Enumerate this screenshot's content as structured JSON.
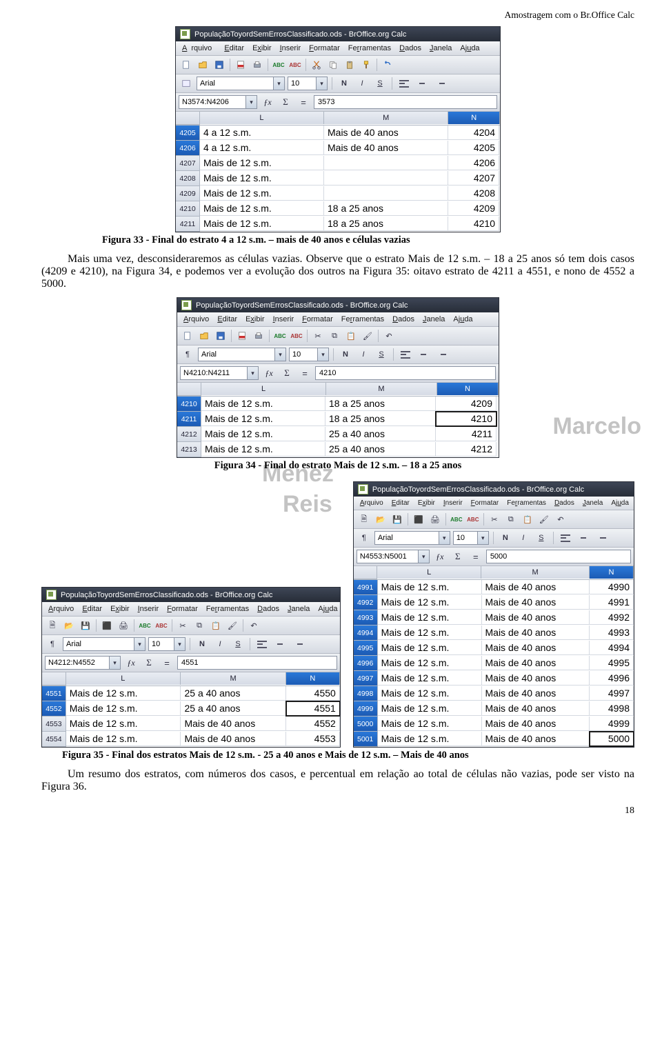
{
  "header_right": "Amostragem com o Br.Office Calc",
  "page_number": "18",
  "calc_common": {
    "title_suffix": " - BrOffice.org Calc",
    "doc_name": "PopulaçãoToyordSemErrosClassificado.ods",
    "menu": [
      "Arquivo",
      "Editar",
      "Exibir",
      "Inserir",
      "Formatar",
      "Ferramentas",
      "Dados",
      "Janela",
      "Ajuda"
    ],
    "font_name": "Arial",
    "font_size": "10",
    "style_btns": {
      "bold": "N",
      "italic": "I",
      "under": "S"
    }
  },
  "fig33": {
    "caption": "Figura 33 - Final do estrato 4 a 12 s.m. – mais de 40 anos  e células vazias",
    "namebox": "N3574:N4206",
    "formula": "3573",
    "col_widths": {
      "rowhead": 34,
      "L": 180,
      "M": 180,
      "N": 74
    },
    "cols": [
      "L",
      "M",
      "N"
    ],
    "sel_col": "N",
    "sel_rows": [
      "4205",
      "4206"
    ],
    "rows": [
      {
        "r": "4205",
        "L": "4 a 12 s.m.",
        "M": "Mais de 40 anos",
        "N": "4204"
      },
      {
        "r": "4206",
        "L": "4 a 12 s.m.",
        "M": "Mais de 40 anos",
        "N": "4205"
      },
      {
        "r": "4207",
        "L": "Mais de 12 s.m.",
        "M": "",
        "N": "4206"
      },
      {
        "r": "4208",
        "L": "Mais de 12 s.m.",
        "M": "",
        "N": "4207"
      },
      {
        "r": "4209",
        "L": "Mais de 12 s.m.",
        "M": "",
        "N": "4208"
      },
      {
        "r": "4210",
        "L": "Mais de 12 s.m.",
        "M": "18 a 25 anos",
        "N": "4209"
      },
      {
        "r": "4211",
        "L": "Mais de 12 s.m.",
        "M": "18 a 25 anos",
        "N": "4210"
      }
    ]
  },
  "para1": "Mais uma vez, desconsideraremos as células vazias. Observe que o estrato Mais de 12 s.m. – 18 a 25 anos só tem dois casos (4209 e 4210), na Figura 34, e podemos ver a evolução dos outros na Figura 35: oitavo estrato de 4211 a 4551, e nono de 4552 a 5000.",
  "fig34": {
    "caption": "Figura 34 - Final do estrato Mais de 12 s.m. – 18 a 25 anos",
    "namebox": "N4210:N4211",
    "formula": "4210",
    "col_widths": {
      "rowhead": 34,
      "L": 180,
      "M": 160,
      "N": 88
    },
    "cols": [
      "L",
      "M",
      "N"
    ],
    "sel_col": "N",
    "sel_rows": [
      "4210",
      "4211"
    ],
    "selcell_row": "4211",
    "rows": [
      {
        "r": "4210",
        "L": "Mais de 12 s.m.",
        "M": "18 a 25 anos",
        "N": "4209"
      },
      {
        "r": "4211",
        "L": "Mais de 12 s.m.",
        "M": "18 a 25 anos",
        "N": "4210"
      },
      {
        "r": "4212",
        "L": "Mais de 12 s.m.",
        "M": "25 a 40 anos",
        "N": "4211"
      },
      {
        "r": "4213",
        "L": "Mais de 12 s.m.",
        "M": "25 a 40 anos",
        "N": "4212"
      }
    ]
  },
  "fig35a": {
    "namebox": "N4212:N4552",
    "formula": "4551",
    "col_widths": {
      "rowhead": 34,
      "L": 168,
      "M": 154,
      "N": 78
    },
    "cols": [
      "L",
      "M",
      "N"
    ],
    "sel_col": "N",
    "sel_rows": [
      "4551",
      "4552"
    ],
    "selcell_row": "4552",
    "rows": [
      {
        "r": "4551",
        "L": "Mais de 12 s.m.",
        "M": "25 a 40 anos",
        "N": "4550"
      },
      {
        "r": "4552",
        "L": "Mais de 12 s.m.",
        "M": "25 a 40 anos",
        "N": "4551"
      },
      {
        "r": "4553",
        "L": "Mais de 12 s.m.",
        "M": "Mais de 40 anos",
        "N": "4552"
      },
      {
        "r": "4554",
        "L": "Mais de 12 s.m.",
        "M": "Mais de 40 anos",
        "N": "4553"
      }
    ]
  },
  "fig35b": {
    "namebox": "N4553:N5001",
    "formula": "5000",
    "col_widths": {
      "rowhead": 34,
      "L": 152,
      "M": 158,
      "N": 64
    },
    "cols": [
      "L",
      "M",
      "N"
    ],
    "sel_col": "N",
    "sel_rows": [
      "4991",
      "4992",
      "4993",
      "4994",
      "4995",
      "4996",
      "4997",
      "4998",
      "4999",
      "5000",
      "5001"
    ],
    "selcell_row": "5001",
    "rows": [
      {
        "r": "4991",
        "L": "Mais de 12 s.m.",
        "M": "Mais de 40 anos",
        "N": "4990"
      },
      {
        "r": "4992",
        "L": "Mais de 12 s.m.",
        "M": "Mais de 40 anos",
        "N": "4991"
      },
      {
        "r": "4993",
        "L": "Mais de 12 s.m.",
        "M": "Mais de 40 anos",
        "N": "4992"
      },
      {
        "r": "4994",
        "L": "Mais de 12 s.m.",
        "M": "Mais de 40 anos",
        "N": "4993"
      },
      {
        "r": "4995",
        "L": "Mais de 12 s.m.",
        "M": "Mais de 40 anos",
        "N": "4994"
      },
      {
        "r": "4996",
        "L": "Mais de 12 s.m.",
        "M": "Mais de 40 anos",
        "N": "4995"
      },
      {
        "r": "4997",
        "L": "Mais de 12 s.m.",
        "M": "Mais de 40 anos",
        "N": "4996"
      },
      {
        "r": "4998",
        "L": "Mais de 12 s.m.",
        "M": "Mais de 40 anos",
        "N": "4997"
      },
      {
        "r": "4999",
        "L": "Mais de 12 s.m.",
        "M": "Mais de 40 anos",
        "N": "4998"
      },
      {
        "r": "5000",
        "L": "Mais de 12 s.m.",
        "M": "Mais de 40 anos",
        "N": "4999"
      },
      {
        "r": "5001",
        "L": "Mais de 12 s.m.",
        "M": "Mais de 40 anos",
        "N": "5000"
      }
    ]
  },
  "fig35_caption": "Figura 35 - Final dos estratos Mais de 12 s.m. - 25 a 40 anos e Mais de 12 s.m. – Mais de 40 anos",
  "para2": "Um resumo dos estratos, com números dos casos, e percentual em relação ao total de células não vazias, pode ser visto na Figura 36.",
  "watermark": {
    "a": "Marcelo",
    "b": "Menez",
    "c": "Reis"
  }
}
